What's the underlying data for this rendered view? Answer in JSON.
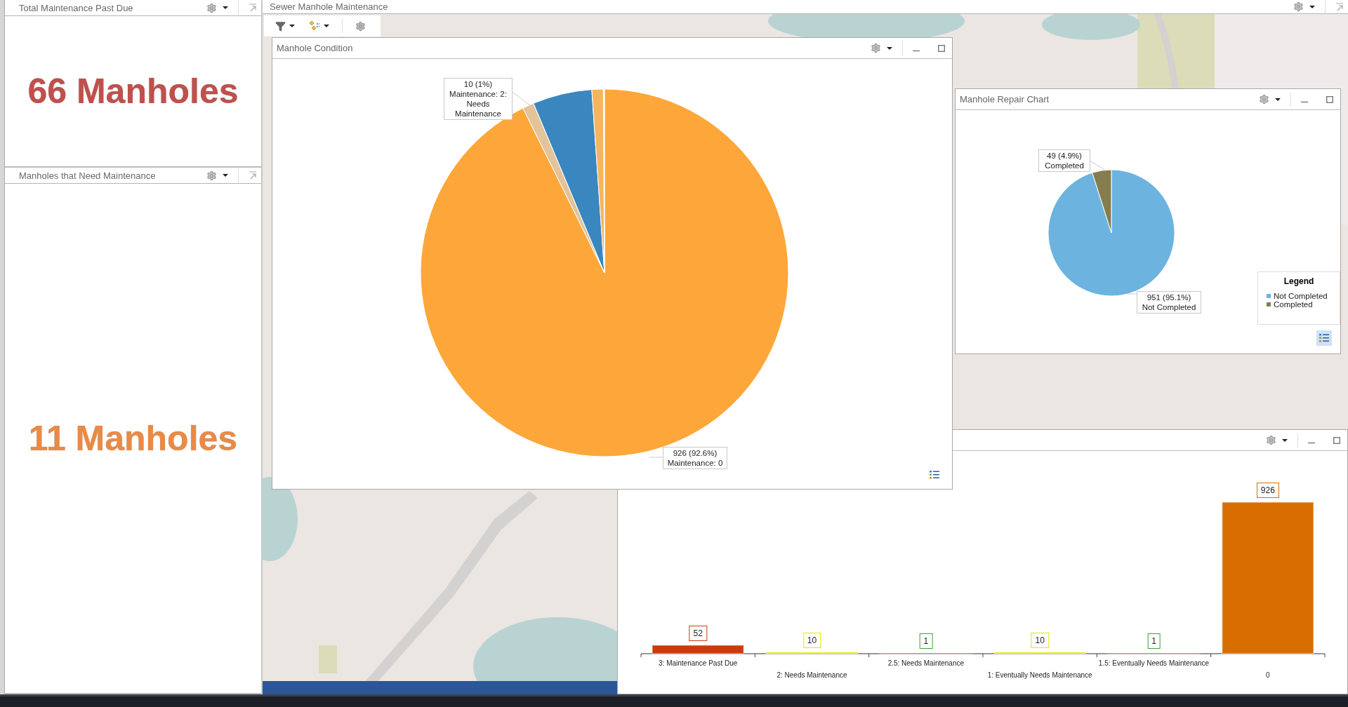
{
  "left_panels": [
    {
      "title": "Total Maintenance Past Due",
      "value": "66 Manholes",
      "color": "#c0504d"
    },
    {
      "title": "Manholes that Need Maintenance",
      "value": "11 Manholes",
      "color": "#eb8a44"
    }
  ],
  "main_panel": {
    "title": "Sewer Manhole Maintenance"
  },
  "condition_window": {
    "title": "Manhole Condition",
    "chart_data": {
      "type": "pie",
      "values": [
        92.6,
        1.0,
        null,
        5.2,
        1.0,
        0.1
      ],
      "colors": [
        "#fda73a",
        "#e3c39a",
        "#f3e0c8",
        "#3a87bf",
        "#f6b55c",
        "#fbefe0"
      ]
    },
    "callouts": [
      {
        "value_text": "10 (1%)",
        "label_text": "Maintenance: 2: Needs Maintenance"
      },
      {
        "value_text": "926 (92.6%)",
        "label_text": "Maintenance: 0"
      }
    ]
  },
  "repair_window": {
    "title": "Manhole Repair Chart",
    "chart_data": {
      "type": "pie",
      "values": [
        95.1,
        4.9
      ],
      "colors": [
        "#6cb3e0",
        "#857d4e"
      ]
    },
    "callouts": [
      {
        "value_text": "49 (4.9%)",
        "label_text": "Completed"
      },
      {
        "value_text": "951 (95.1%)",
        "label_text": "Not Completed"
      }
    ],
    "legend": {
      "title": "Legend",
      "items": [
        {
          "label": "Not Completed",
          "color": "#6cb3e0"
        },
        {
          "label": "Completed",
          "color": "#857d4e"
        }
      ]
    }
  },
  "bar_window": {
    "chart_data": {
      "type": "bar",
      "categories": [
        "3: Maintenance Past Due",
        "2: Needs Maintenance",
        "2.5: Needs Maintenance",
        "1: Eventually Needs Maintenance",
        "1.5: Eventually Needs Maintenance",
        "0"
      ],
      "values": [
        52,
        10,
        1,
        10,
        1,
        926
      ],
      "colors": [
        "#cc3a0c",
        "#e6e600",
        "#3f9f3f",
        "#e6e600",
        "#3f9f3f",
        "#d96e00"
      ],
      "data_labels": true
    }
  }
}
